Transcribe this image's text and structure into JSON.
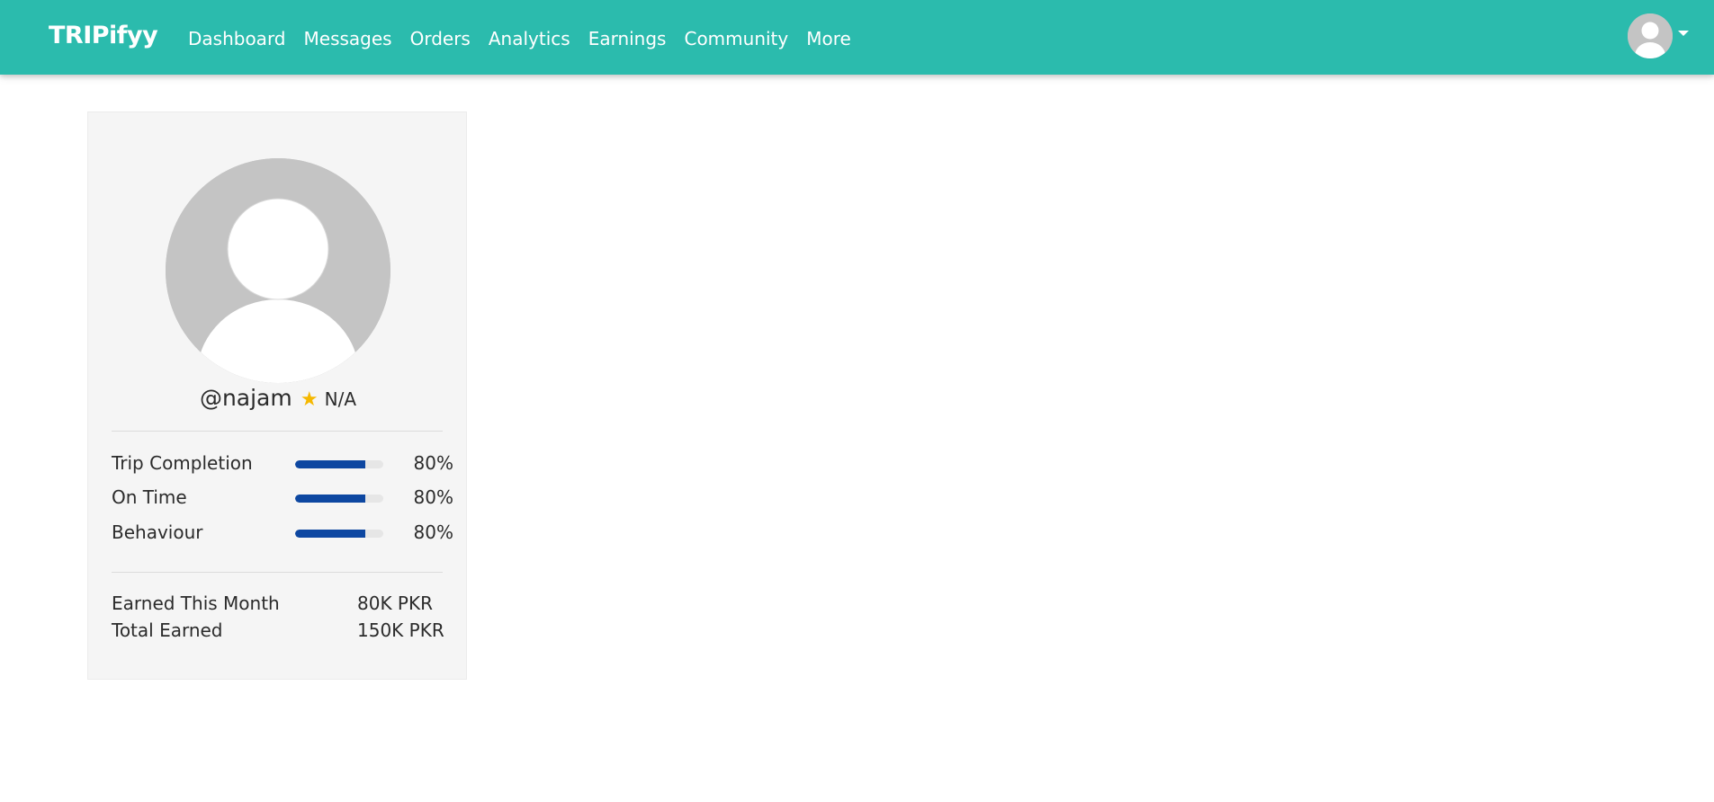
{
  "brand": "TRIPifyy",
  "nav": {
    "items": [
      {
        "label": "Dashboard"
      },
      {
        "label": "Messages"
      },
      {
        "label": "Orders"
      },
      {
        "label": "Analytics"
      },
      {
        "label": "Earnings"
      },
      {
        "label": "Community"
      },
      {
        "label": "More"
      }
    ]
  },
  "profile": {
    "handle": "@najam",
    "star_icon": "star-icon",
    "rating": "N/A",
    "avatar_icon": "user-avatar-placeholder"
  },
  "stats": [
    {
      "label": "Trip Completion",
      "value": "80%",
      "progress": 0.8
    },
    {
      "label": "On Time",
      "value": "80%",
      "progress": 0.8
    },
    {
      "label": "Behaviour",
      "value": "80%",
      "progress": 0.8
    }
  ],
  "earnings": [
    {
      "label": "Earned This Month",
      "value": "80K PKR"
    },
    {
      "label": "Total Earned",
      "value": "150K PKR"
    }
  ],
  "colors": {
    "navbar": "#2bbbad",
    "progress_fill": "#0d47a1",
    "star": "#f5b800",
    "card_bg": "#f5f5f5",
    "avatar_bg": "#c4c4c4"
  }
}
